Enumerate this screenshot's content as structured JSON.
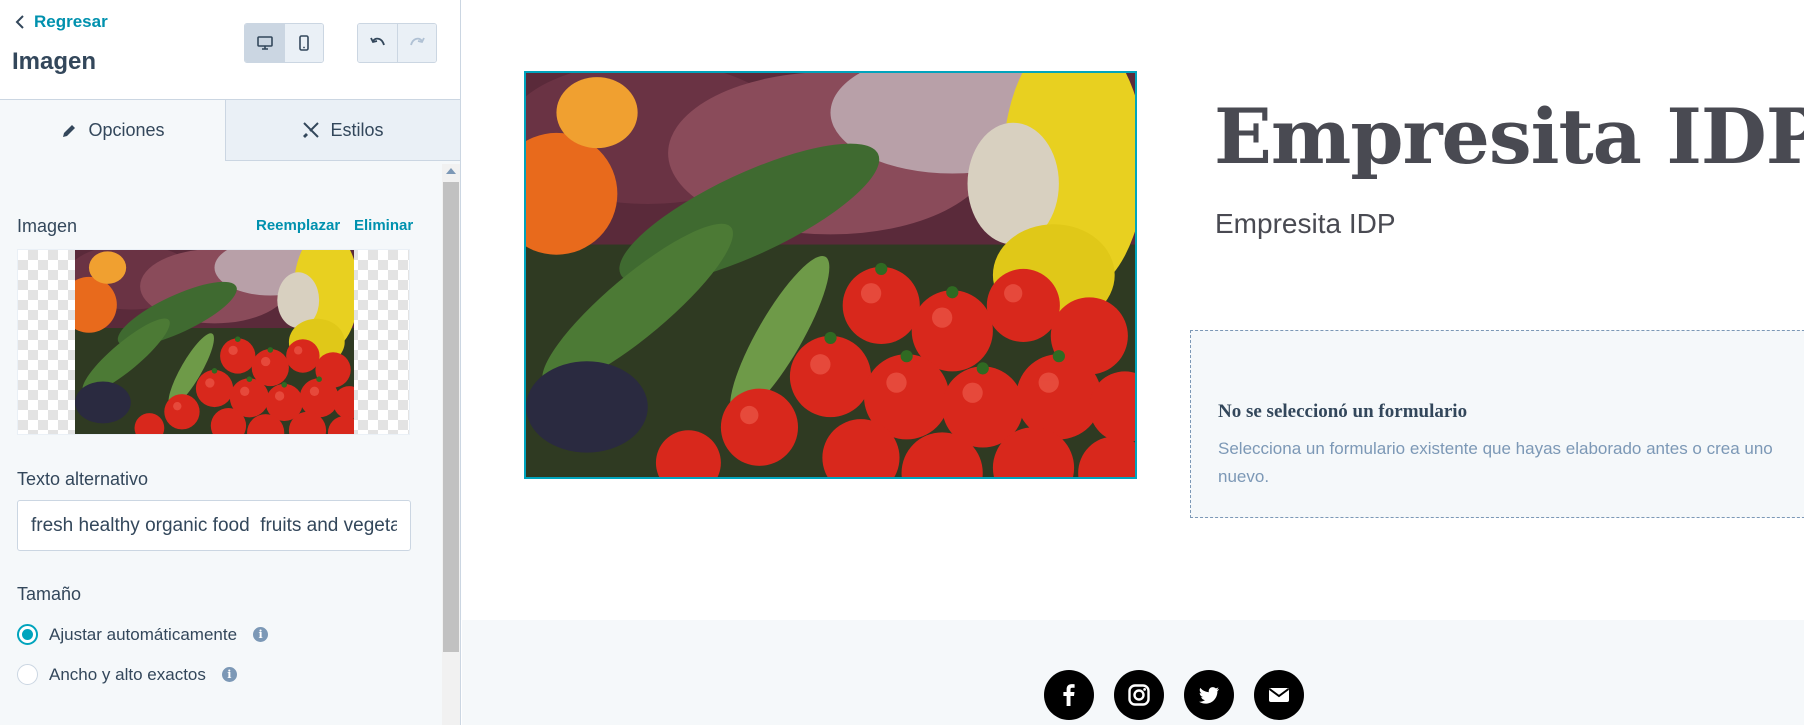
{
  "sidebar": {
    "back_label": "Regresar",
    "title": "Imagen",
    "tabs": [
      {
        "label": "Opciones",
        "icon": "pencil-icon",
        "active": true
      },
      {
        "label": "Estilos",
        "icon": "brush-icon",
        "active": false
      }
    ],
    "image_section": {
      "label": "Imagen",
      "replace_label": "Reemplazar",
      "remove_label": "Eliminar"
    },
    "alt_text": {
      "label": "Texto alternativo",
      "value": "fresh healthy organic food  fruits and vegetables"
    },
    "size": {
      "label": "Tamaño",
      "options": [
        {
          "label": "Ajustar automáticamente",
          "selected": true
        },
        {
          "label": "Ancho y alto exactos",
          "selected": false
        }
      ]
    }
  },
  "preview": {
    "title": "Empresita IDP",
    "subtitle": "Empresita IDP",
    "form": {
      "title": "No se seleccionó un formulario",
      "description": "Selecciona un formulario existente que hayas elaborado antes o crea uno nuevo."
    },
    "social_icons": [
      "facebook-icon",
      "instagram-icon",
      "twitter-icon",
      "email-icon"
    ]
  },
  "colors": {
    "accent": "#0091ae",
    "selection": "#00a4bd",
    "text": "#33475b",
    "muted": "#7c98b6",
    "panel_bg": "#f5f8fa"
  }
}
